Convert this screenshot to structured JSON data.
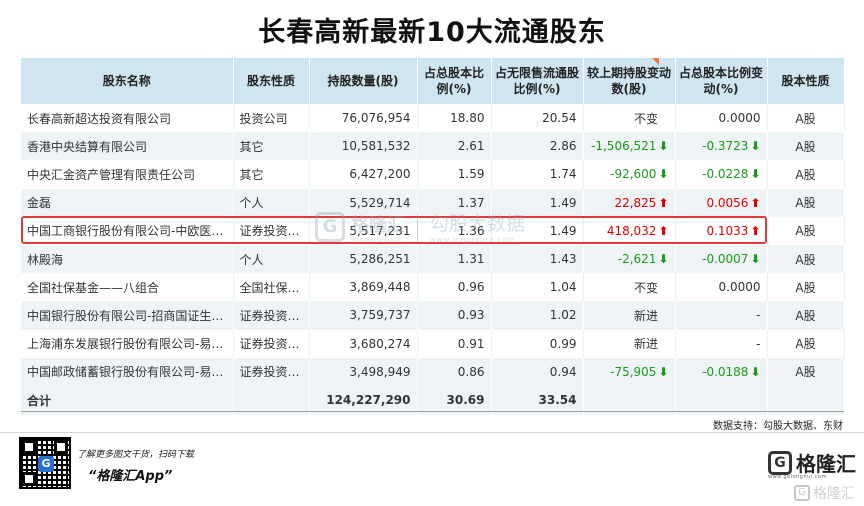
{
  "title": "长春高新最新10大流通股东",
  "headers": [
    "股东名称",
    "股东性质",
    "持股数量(股)",
    "占总股本比例(%)",
    "占无限售流通股比例(%)",
    "较上期持股变动数(股)",
    "占总股本比例变动(%)",
    "股本性质"
  ],
  "rows": [
    {
      "name": "长春高新超达投资有限公司",
      "type": "投资公司",
      "shares": "76,076,954",
      "pct_total": "18.80",
      "pct_float": "20.54",
      "change": "不变",
      "change_dir": "none",
      "pct_change": "0.0000",
      "pct_change_dir": "none",
      "nature": "A股"
    },
    {
      "name": "香港中央结算有限公司",
      "type": "其它",
      "shares": "10,581,532",
      "pct_total": "2.61",
      "pct_float": "2.86",
      "change": "-1,506,521",
      "change_dir": "down",
      "pct_change": "-0.3723",
      "pct_change_dir": "down",
      "nature": "A股"
    },
    {
      "name": "中央汇金资产管理有限责任公司",
      "type": "其它",
      "shares": "6,427,200",
      "pct_total": "1.59",
      "pct_float": "1.74",
      "change": "-92,600",
      "change_dir": "down",
      "pct_change": "-0.0228",
      "pct_change_dir": "down",
      "nature": "A股"
    },
    {
      "name": "金磊",
      "type": "个人",
      "shares": "5,529,714",
      "pct_total": "1.37",
      "pct_float": "1.49",
      "change": "22,825",
      "change_dir": "up",
      "pct_change": "0.0056",
      "pct_change_dir": "up",
      "nature": "A股"
    },
    {
      "name": "中国工商银行股份有限公司-中欧医疗健康混合型证券投资基金",
      "type": "证券投资基金",
      "shares": "5,517,231",
      "pct_total": "1.36",
      "pct_float": "1.49",
      "change": "418,032",
      "change_dir": "up",
      "pct_change": "0.1033",
      "pct_change_dir": "up",
      "nature": "A股"
    },
    {
      "name": "林殿海",
      "type": "个人",
      "shares": "5,286,251",
      "pct_total": "1.31",
      "pct_float": "1.43",
      "change": "-2,621",
      "change_dir": "down",
      "pct_change": "-0.0007",
      "pct_change_dir": "down",
      "nature": "A股"
    },
    {
      "name": "全国社保基金——八组合",
      "type": "全国社保基金",
      "shares": "3,869,448",
      "pct_total": "0.96",
      "pct_float": "1.04",
      "change": "不变",
      "change_dir": "none",
      "pct_change": "0.0000",
      "pct_change_dir": "none",
      "nature": "A股"
    },
    {
      "name": "中国银行股份有限公司-招商国证生物医药指数分级证券投资基金",
      "type": "证券投资基金",
      "shares": "3,759,737",
      "pct_total": "0.93",
      "pct_float": "1.02",
      "change": "新进",
      "change_dir": "none",
      "pct_change": "-",
      "pct_change_dir": "none",
      "nature": "A股"
    },
    {
      "name": "上海浦东发展银行股份有限公司-易方达医疗保健行业混合型证券投资基金",
      "type": "证券投资基金",
      "shares": "3,680,274",
      "pct_total": "0.91",
      "pct_float": "0.99",
      "change": "新进",
      "change_dir": "none",
      "pct_change": "-",
      "pct_change_dir": "none",
      "nature": "A股"
    },
    {
      "name": "中国邮政储蓄银行股份有限公司-易方达医疗保健行业混合型证券投资基金",
      "type": "证券投资基金",
      "shares": "3,498,949",
      "pct_total": "0.86",
      "pct_float": "0.94",
      "change": "-75,905",
      "change_dir": "down",
      "pct_change": "-0.0188",
      "pct_change_dir": "down",
      "nature": "A股"
    }
  ],
  "total": {
    "label": "合计",
    "shares": "124,227,290",
    "pct_total": "30.69",
    "pct_float": "33.54"
  },
  "source": "数据支持：勾股大数据、东财",
  "watermark": {
    "logo": "G",
    "name": "格隆汇",
    "url": "www.gelonghui.com",
    "brand2": "勾股大数据",
    "url2": "www.gogudata.com"
  },
  "footer": {
    "promo_line1": "了解更多图文干货，扫码下载",
    "promo_line2": "“格隆汇App”",
    "brand_name": "格隆汇",
    "brand_sub": "www.gelonghui.com",
    "watermark_text": "格隆汇"
  },
  "colors": {
    "header_bg": "#cfe6f0",
    "row_alt": "#eef3f6",
    "up": "#e00000",
    "down": "#1a9a1a",
    "highlight": "#e03a3a"
  }
}
